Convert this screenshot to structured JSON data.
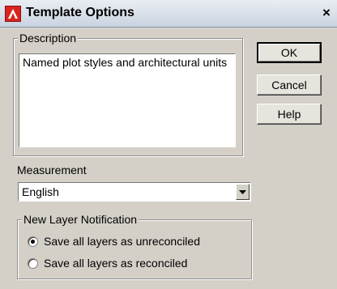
{
  "window": {
    "title": "Template Options",
    "close_glyph": "×",
    "icon": "autocad-icon"
  },
  "description": {
    "label": "Description",
    "text": "Named plot styles and architectural units"
  },
  "buttons": {
    "ok": "OK",
    "cancel": "Cancel",
    "help": "Help"
  },
  "measurement": {
    "label": "Measurement",
    "selected": "English"
  },
  "new_layer_notification": {
    "label": "New Layer Notification",
    "options": [
      {
        "label": "Save all layers as unreconciled",
        "selected": true
      },
      {
        "label": "Save all layers as reconciled",
        "selected": false
      }
    ]
  }
}
